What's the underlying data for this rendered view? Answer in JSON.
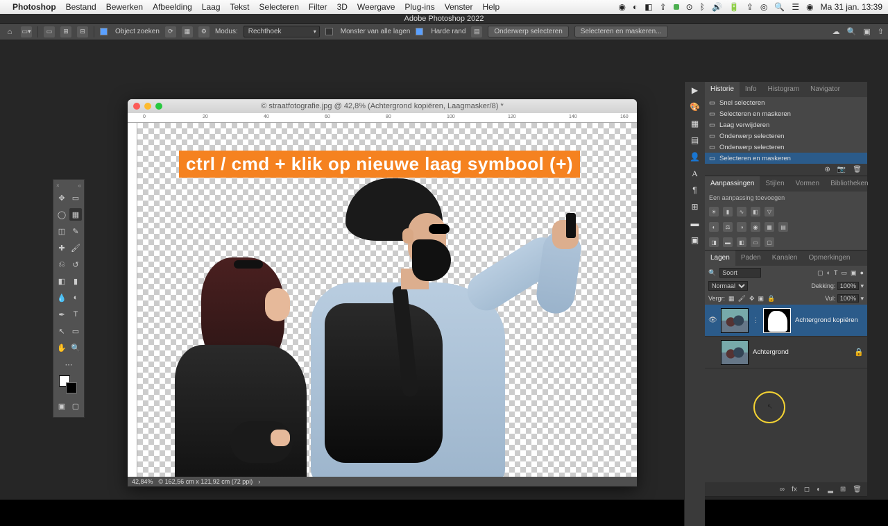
{
  "os": {
    "clock": "Ma 31 jan.  13:39"
  },
  "menu": {
    "app": "Photoshop",
    "items": [
      "Bestand",
      "Bewerken",
      "Afbeelding",
      "Laag",
      "Tekst",
      "Selecteren",
      "Filter",
      "3D",
      "Weergave",
      "Plug-ins",
      "Venster",
      "Help"
    ]
  },
  "app_title": "Adobe Photoshop 2022",
  "options": {
    "find": "Object zoeken",
    "mode": "Modus:",
    "shape": "Rechthoek",
    "sample": "Monster van alle lagen",
    "hard": "Harde rand",
    "select_subject": "Onderwerp selecteren",
    "select_mask": "Selecteren en maskeren..."
  },
  "doc": {
    "title": "© straatfotografie.jpg @ 42,8% (Achtergrond kopiëren, Laagmasker/8) *",
    "zoom": "42,84%",
    "dims": "© 162,56 cm x 121,92 cm (72 ppi)",
    "ruler": [
      "0",
      "20",
      "40",
      "60",
      "80",
      "100",
      "120",
      "140",
      "160"
    ]
  },
  "overlay": "ctrl / cmd + klik op nieuwe laag symbool (+)",
  "panels": {
    "history": {
      "tabs": [
        "Historie",
        "Info",
        "Histogram",
        "Navigator"
      ],
      "items": [
        "Snel selecteren",
        "Selecteren en maskeren",
        "Laag verwijderen",
        "Onderwerp selecteren",
        "Onderwerp selecteren",
        "Selecteren en maskeren"
      ]
    },
    "adjustments": {
      "tabs": [
        "Aanpassingen",
        "Stijlen",
        "Vormen",
        "Bibliotheken"
      ],
      "hint": "Een aanpassing toevoegen"
    },
    "layers": {
      "tabs": [
        "Lagen",
        "Paden",
        "Kanalen",
        "Opmerkingen"
      ],
      "search": "Soort",
      "blend": "Normaal",
      "opacity_label": "Dekking:",
      "opacity": "100%",
      "fill_label": "Vul:",
      "fill": "100%",
      "lock_label": "Vergr:",
      "items": [
        {
          "name": "Achtergrond kopiëren",
          "masked": true,
          "visible": true
        },
        {
          "name": "Achtergrond",
          "locked": true,
          "visible": false
        }
      ]
    }
  }
}
